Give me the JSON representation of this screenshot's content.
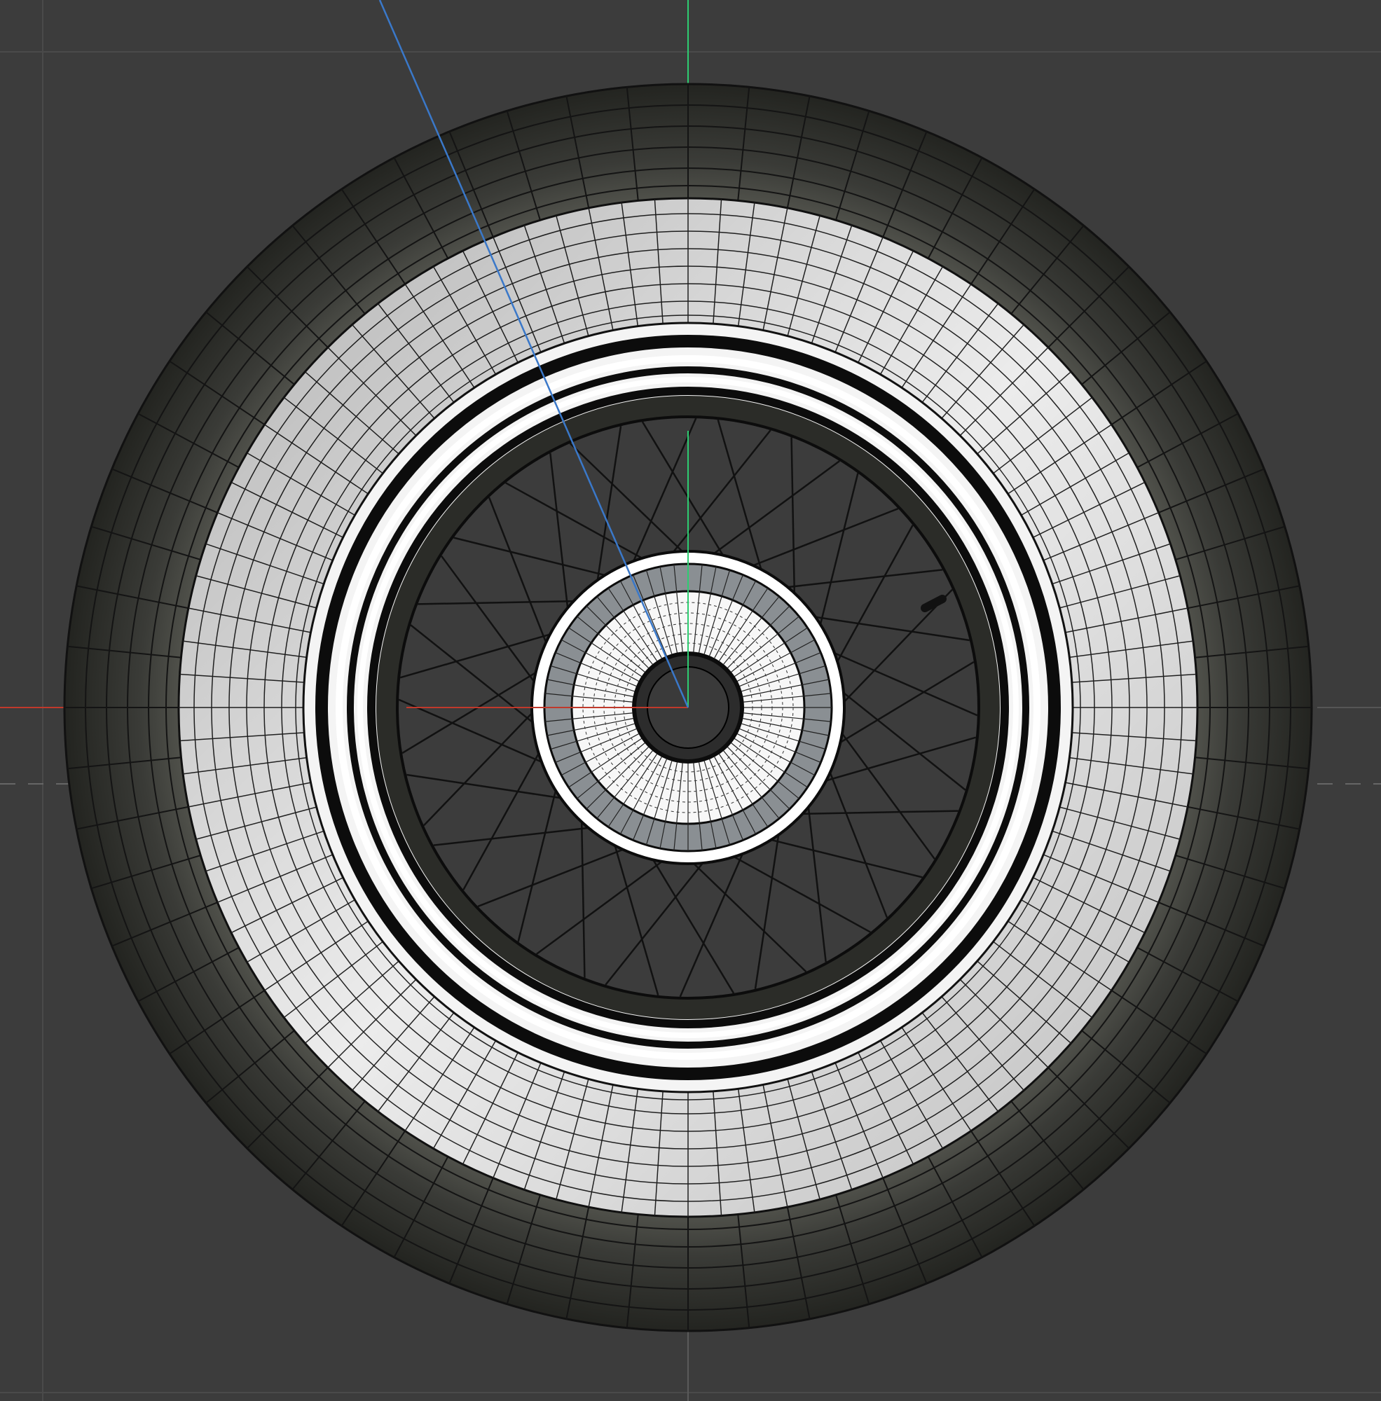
{
  "viewport": {
    "background": "#3c3c3c",
    "grid_color": "#4a4a4a",
    "axis_x_color": "#c0392b",
    "axis_y_color": "#2ecc71",
    "axis_z_color": "#3a78c9"
  },
  "wheel": {
    "tire_color": "#2a2b28",
    "whitewall_color": "#ececec",
    "wire_color": "#111111",
    "tire_segments": 64,
    "whitewall_segments": 96,
    "spoke_count": 48,
    "hub_segments": 64
  }
}
